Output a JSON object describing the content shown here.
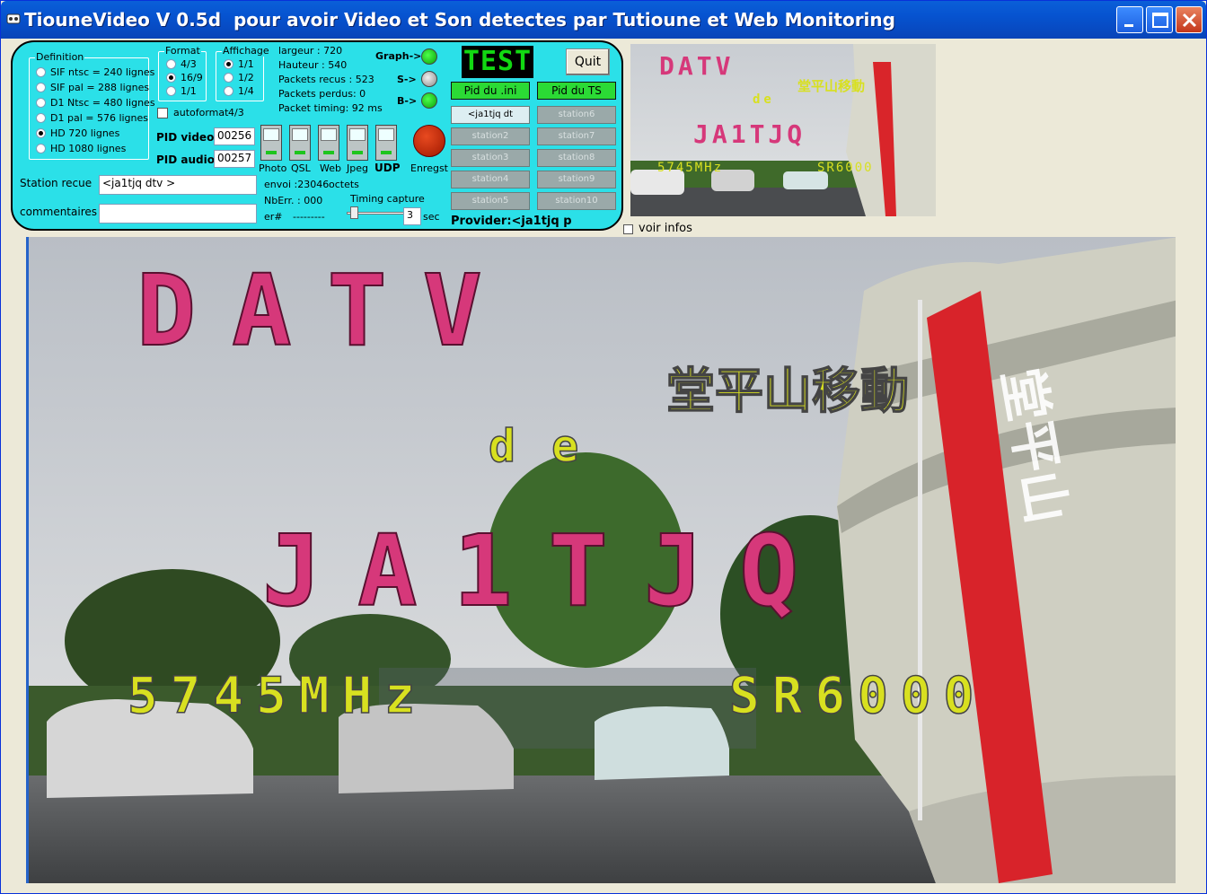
{
  "window": {
    "title": "TiouneVideo V 0.5d  pour avoir Video et Son detectes par Tutioune et Web Monitoring",
    "controls": [
      "minimize",
      "maximize",
      "close"
    ]
  },
  "definition": {
    "legend": "Definition",
    "options": [
      "SIF ntsc = 240 lignes",
      "SIF pal = 288 lignes",
      "D1 Ntsc = 480 lignes",
      "D1 pal = 576 lignes",
      "HD 720 lignes",
      "HD 1080 lignes"
    ],
    "selected": 4
  },
  "format": {
    "legend": "Format",
    "options": [
      "4/3",
      "16/9",
      "1/1"
    ],
    "selected": 1
  },
  "affichage": {
    "legend": "Affichage",
    "options": [
      "1/1",
      "1/2",
      "1/4"
    ],
    "selected": 0
  },
  "autoformat": {
    "label": "autoformat",
    "value": "4/3"
  },
  "pid": {
    "video_label": "PID video:",
    "video_value": "00256",
    "audio_label": "PID audio:",
    "audio_value": "00257"
  },
  "stats": {
    "largeur": "largeur :  720",
    "hauteur": "Hauteur : 540",
    "packets_recus": "Packets recus :  523",
    "packets_perdus": "Packets perdus: 0",
    "packet_timing": "Packet timing: 92 ms",
    "envoi": "envoi :23046",
    "octets": "octets",
    "nberr": "NbErr. : 000",
    "er": "er#",
    "er_value": "---------"
  },
  "indicators": {
    "graph": "Graph->",
    "s": "S->",
    "b": "B->"
  },
  "test_display": "TEST",
  "quit_label": "Quit",
  "pid_ini_label": "Pid du .ini",
  "pid_ts_label": "Pid du TS",
  "stations_left": [
    "<ja1tjq dt",
    "station2",
    "station3",
    "station4",
    "station5"
  ],
  "stations_right": [
    "station6",
    "station7",
    "station8",
    "station9",
    "station10"
  ],
  "switches": [
    "Photo",
    "QSL",
    "Web",
    "Jpeg",
    "UDP"
  ],
  "enregst_label": "Enregst",
  "timing": {
    "label": "Timing capture",
    "value": "3",
    "unit": "sec"
  },
  "station_recue": {
    "label": "Station recue",
    "value": "<ja1tjq dtv >"
  },
  "commentaires": {
    "label": "commentaires",
    "value": ""
  },
  "provider": "Provider:<ja1tjq  p",
  "voir_infos": "voir infos",
  "overlay": {
    "line1": "DATV",
    "line2": "堂平山移動",
    "line3": "de",
    "line4": "JA1TJQ",
    "line5a": "5745MHz",
    "line5b": "SR6000",
    "banner": "堂平山"
  },
  "colors": {
    "panel": "#2be0e8",
    "led_green": "#1ec51e",
    "test_text": "#12d912",
    "overlay_magenta": "#d6387a",
    "overlay_yellow": "#d8e020"
  }
}
